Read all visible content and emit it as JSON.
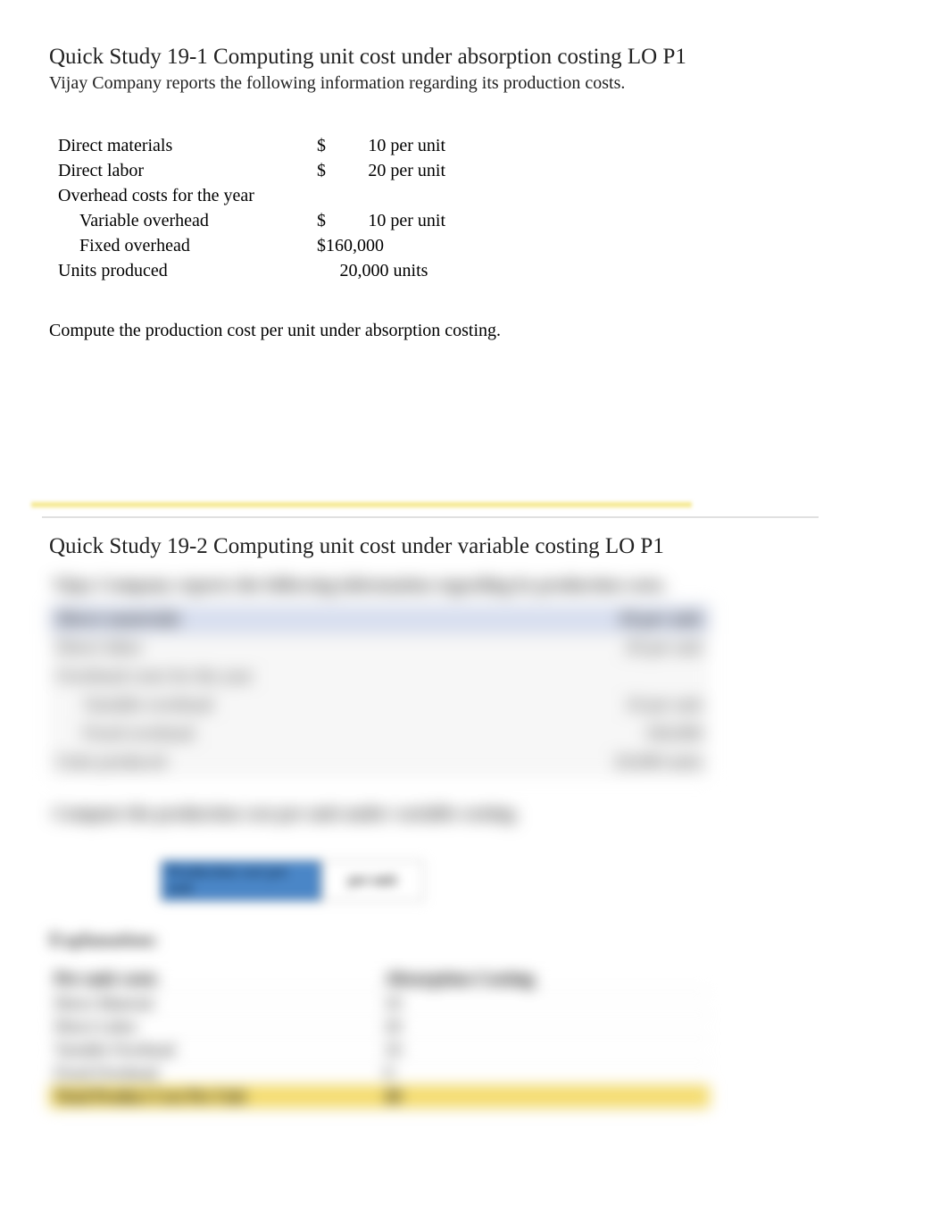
{
  "section1": {
    "title": "Quick Study 19-1 Computing unit cost under absorption costing LO P1",
    "subtitle": "Vijay Company reports the following information regarding its production costs.",
    "rows": {
      "direct_materials": {
        "label": "Direct materials",
        "currency": "$",
        "value": "10 per unit"
      },
      "direct_labor": {
        "label": "Direct labor",
        "currency": "$",
        "value": "20 per unit"
      },
      "overhead_header": {
        "label": "Overhead costs for the year"
      },
      "variable_overhead": {
        "label": "Variable overhead",
        "currency": "$",
        "value": "10 per unit"
      },
      "fixed_overhead": {
        "label": "Fixed overhead",
        "full": "$160,000"
      },
      "units_produced": {
        "label": "Units produced",
        "full": "20,000 units"
      }
    },
    "question": "Compute the production cost per unit under absorption costing."
  },
  "section2": {
    "title": "Quick Study 19-2 Computing unit cost under variable costing LO P1",
    "blurred_intro": "Vijay Company reports the following information regarding its production costs.",
    "blurred_rows": {
      "r1": {
        "label": "Direct materials",
        "val": "10 per unit"
      },
      "r2": {
        "label": "Direct labor",
        "val": "20 per unit"
      },
      "r3": {
        "label": "Overhead costs for the year",
        "val": ""
      },
      "r4": {
        "label": "Variable overhead",
        "val": "10 per unit"
      },
      "r5": {
        "label": "Fixed overhead",
        "val": "160,000"
      },
      "r6": {
        "label": "Units produced",
        "val": "20,000 units"
      }
    },
    "blurred_question": "Compute the production cost per unit under variable costing.",
    "blue_box": "Production cost per unit",
    "white_box": "per unit",
    "explanation_label": "Explanation:",
    "table": {
      "head1": "Per unit costs",
      "head2": "Absorption Costing",
      "r1": {
        "a": "Direct Material",
        "b": "10"
      },
      "r2": {
        "a": "Direct Labor",
        "b": "20"
      },
      "r3": {
        "a": "Variable Overhead",
        "b": "10"
      },
      "r4": {
        "a": "Fixed Overhead",
        "b": "8"
      },
      "total": {
        "a": "Total Product Cost Per Unit",
        "b": "48"
      }
    }
  }
}
